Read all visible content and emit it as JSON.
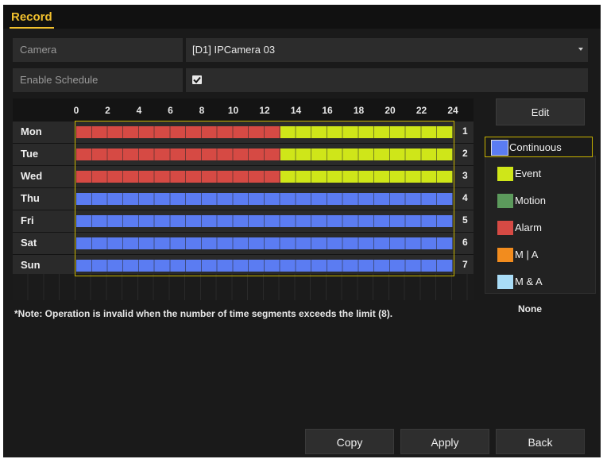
{
  "tab": {
    "label": "Record"
  },
  "camera": {
    "label": "Camera",
    "value": "[D1] IPCamera 03"
  },
  "schedule": {
    "label": "Enable Schedule",
    "enabled": true
  },
  "hours": [
    "0",
    "2",
    "4",
    "6",
    "8",
    "10",
    "12",
    "14",
    "16",
    "18",
    "20",
    "22",
    "24"
  ],
  "days": [
    {
      "label": "Mon",
      "num": "1",
      "segments": [
        {
          "type": "Alarm",
          "start": 0,
          "end": 13
        },
        {
          "type": "Event",
          "start": 13,
          "end": 24
        }
      ]
    },
    {
      "label": "Tue",
      "num": "2",
      "segments": [
        {
          "type": "Alarm",
          "start": 0,
          "end": 13
        },
        {
          "type": "Event",
          "start": 13,
          "end": 24
        }
      ]
    },
    {
      "label": "Wed",
      "num": "3",
      "segments": [
        {
          "type": "Alarm",
          "start": 0,
          "end": 13
        },
        {
          "type": "Event",
          "start": 13,
          "end": 24
        }
      ]
    },
    {
      "label": "Thu",
      "num": "4",
      "segments": [
        {
          "type": "Continuous",
          "start": 0,
          "end": 24
        }
      ]
    },
    {
      "label": "Fri",
      "num": "5",
      "segments": [
        {
          "type": "Continuous",
          "start": 0,
          "end": 24
        }
      ]
    },
    {
      "label": "Sat",
      "num": "6",
      "segments": [
        {
          "type": "Continuous",
          "start": 0,
          "end": 24
        }
      ]
    },
    {
      "label": "Sun",
      "num": "7",
      "segments": [
        {
          "type": "Continuous",
          "start": 0,
          "end": 24
        }
      ]
    }
  ],
  "edit_label": "Edit",
  "legend": [
    {
      "label": "Continuous",
      "color": "#5b7cf2",
      "selected": true
    },
    {
      "label": "Event",
      "color": "#cfe619"
    },
    {
      "label": "Motion",
      "color": "#5c9a5c"
    },
    {
      "label": "Alarm",
      "color": "#d64a44"
    },
    {
      "label": "M | A",
      "color": "#f28c1e"
    },
    {
      "label": "M & A",
      "color": "#a9dcf7"
    }
  ],
  "none_label": "None",
  "note": "*Note: Operation is invalid when the number of time segments exceeds the limit (8).",
  "buttons": {
    "copy": "Copy",
    "apply": "Apply",
    "back": "Back"
  }
}
